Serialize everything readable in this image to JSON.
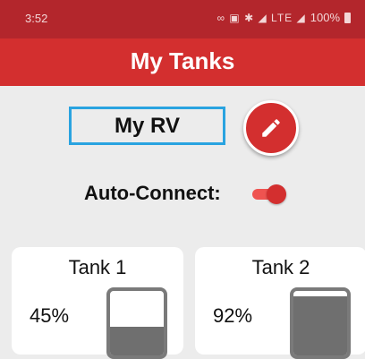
{
  "status_bar": {
    "time": "3:52",
    "icons_text": "∞ ▣ ✱ ◢ LTE ◢",
    "battery": "100%"
  },
  "app_bar": {
    "title": "My Tanks"
  },
  "rv": {
    "name": "My RV",
    "edit_icon": "pencil-icon"
  },
  "auto_connect": {
    "label": "Auto-Connect:",
    "enabled": true
  },
  "tanks": [
    {
      "title": "Tank 1",
      "percent_label": "45%",
      "level": 0.45
    },
    {
      "title": "Tank 2",
      "percent_label": "92%",
      "level": 0.92
    }
  ],
  "colors": {
    "status_bar": "#b3262c",
    "app_bar": "#d32f2f",
    "accent_border": "#29a3e0",
    "gauge_fill": "#6f6f6f",
    "background": "#ececec"
  }
}
